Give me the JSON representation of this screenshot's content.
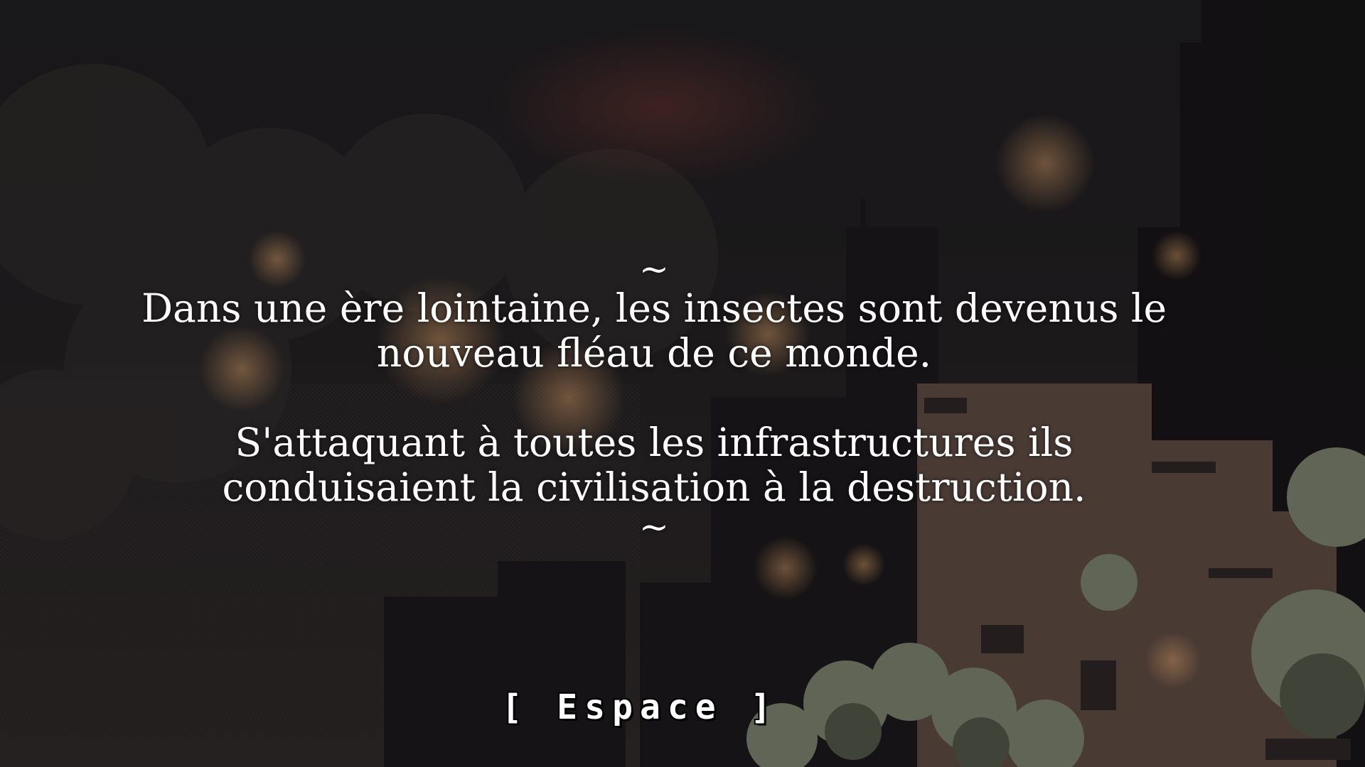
{
  "story": {
    "tilde_top": "~",
    "paragraph_1_line_1": "Dans une ère lointaine, les insectes sont devenus le",
    "paragraph_1_line_2": "nouveau fléau de ce monde.",
    "paragraph_2_line_1": "S'attaquant à toutes les infrastructures ils",
    "paragraph_2_line_2": "conduisaient la civilisation à la destruction.",
    "tilde_bottom": "~"
  },
  "prompt": {
    "open_bracket": "[",
    "label": "Espace",
    "close_bracket": "]"
  },
  "colors": {
    "text": "#ffffff",
    "background": "#1b1a1c",
    "building_dark": "#141213",
    "building_warm": "#6b5448",
    "tree_green": "#8a9478",
    "glow": "#e0a060"
  }
}
